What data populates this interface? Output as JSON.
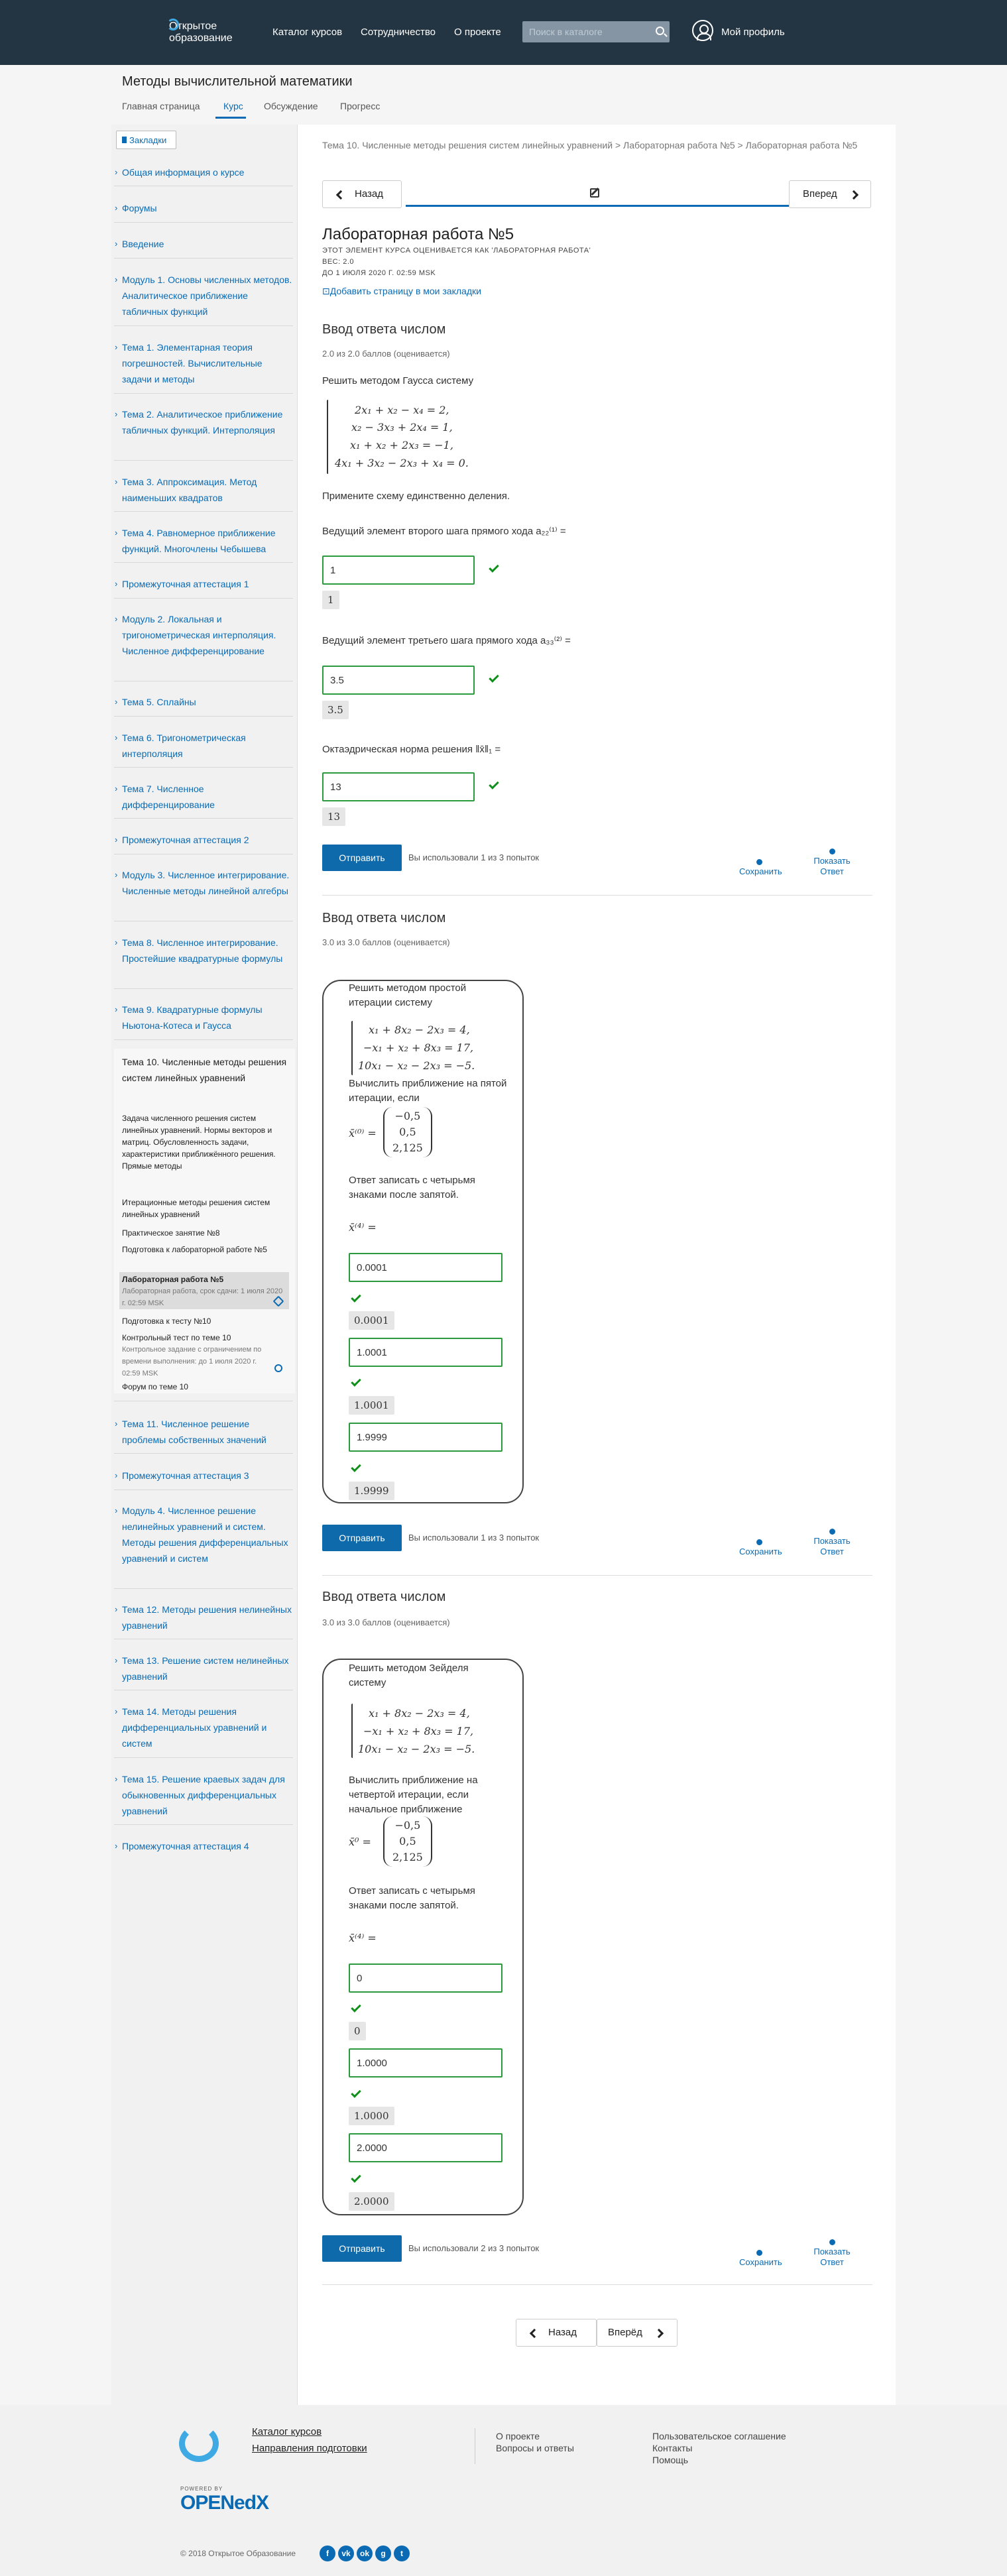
{
  "header": {
    "logo_line1": "Открытое",
    "logo_line2": "образование",
    "nav": [
      "Каталог курсов",
      "Сотрудничество",
      "О проекте"
    ],
    "search_placeholder": "Поиск в каталоге",
    "profile": "Мой профиль"
  },
  "course": {
    "title": "Методы вычислительной математики",
    "tabs": [
      "Главная страница",
      "Курс",
      "Обсуждение",
      "Прогресс"
    ],
    "active_tab": "Курс"
  },
  "sidebar": {
    "bookmarks": "Закладки",
    "items": [
      "Общая информация о курсе",
      "Форумы",
      "Введение",
      "Модуль 1. Основы численных методов. Аналитическое приближение табличных функций",
      "Тема 1. Элементарная теория погрешностей. Вычислительные задачи и методы",
      "Тема 2. Аналитическое приближение табличных функций. Интерполяция",
      "Тема 3. Аппроксимация. Метод наименьших квадратов",
      "Тема 4. Равномерное приближение функций. Многочлены Чебышева",
      "Промежуточная аттестация 1",
      "Модуль 2. Локальная и тригонометрическая интерполяция. Численное дифференцирование",
      "Тема 5. Сплайны",
      "Тема 6. Тригонометрическая интерполяция",
      "Тема 7. Численное дифференцирование",
      "Промежуточная аттестация 2",
      "Модуль 3. Численное интегрирование. Численные методы линейной алгебры",
      "Тема 8. Численное интегрирование. Простейшие квадратурные формулы",
      "Тема 9. Квадратурные формулы Ньютона-Котеса и Гаусса"
    ],
    "active_section": "Тема 10. Численные методы решения систем линейных уравнений",
    "subitems": [
      {
        "title": "Задача численного решения систем линейных уравнений. Нормы векторов и матриц. Обусловленность задачи, характеристики приближённого решения. Прямые методы",
        "note": ""
      },
      {
        "title": "Итерационные методы решения систем линейных уравнений",
        "note": ""
      },
      {
        "title": "Практическое занятие №8",
        "note": ""
      },
      {
        "title": "Подготовка к лабораторной работе №5",
        "note": ""
      },
      {
        "title": "Лабораторная работа №5",
        "note": "Лабораторная работа, срок сдачи: 1 июля 2020 г. 02:59 MSK"
      },
      {
        "title": "Подготовка к тесту №10",
        "note": ""
      },
      {
        "title": "Контрольный тест по теме 10",
        "note": "Контрольное задание с ограничением по времени выполнения: до 1 июля 2020 г. 02:59 MSK"
      },
      {
        "title": "Форум по теме 10",
        "note": ""
      }
    ],
    "items_after": [
      "Тема 11. Численное решение проблемы собственных значений",
      "Промежуточная аттестация 3",
      "Модуль 4. Численное решение нелинейных уравнений и систем. Методы решения дифференциальных уравнений и систем",
      "Тема 12. Методы решения нелинейных уравнений",
      "Тема 13. Решение систем нелинейных уравнений",
      "Тема 14. Методы решения дифференциальных уравнений и систем",
      "Тема 15. Решение краевых задач для обыкновенных дифференциальных уравнений",
      "Промежуточная аттестация 4"
    ]
  },
  "content": {
    "breadcrumb": "Тема 10. Численные методы решения систем линейных уравнений > Лабораторная работа №5 > Лабораторная работа №5",
    "prev": "Назад",
    "next": "Вперед",
    "next_bottom": "Вперёд",
    "unit_title": "Лабораторная работа №5",
    "meta1": "ЭТОТ ЭЛЕМЕНТ КУРСА ОЦЕНИВАЕТСЯ КАК 'ЛАБОРАТОРНАЯ РАБОТА'",
    "meta2": "ВЕС: 2.0",
    "meta3": "ДО 1 ИЮЛЯ 2020 Г. 02:59 MSK",
    "add_bookmark": "Добавить страницу в мои закладки",
    "submit": "Отправить",
    "save": "Сохранить",
    "show_answer": "Показать Ответ"
  },
  "problems": [
    {
      "heading": "Ввод ответа числом",
      "score": "2.0 из 2.0 баллов (оценивается)",
      "intro": "Решить методом Гаусса систему",
      "equations": [
        "2x₁ + x₂ − x₄ = 2,",
        "x₂ − 3x₃ + 2x₄ = 1,",
        "x₁ + x₂ + 2x₃ = −1,",
        "4x₁ + 3x₂ − 2x₃ + x₄ = 0."
      ],
      "note": "Примените схему единственно деления.",
      "questions": [
        "Ведущий элемент второго шага прямого хода a₂₂⁽¹⁾ =",
        "Ведущий элемент третьего шага прямого хода a₃₃⁽²⁾ =",
        "Октаэдрическая норма решения ‖x̄‖₁ ="
      ],
      "answers": [
        "1",
        "3.5",
        "13"
      ],
      "attempts": "Вы использовали 1 из 3 попыток"
    },
    {
      "heading": "Ввод ответа числом",
      "score": "3.0 из 3.0 баллов (оценивается)",
      "intro": "Решить методом простой итерации систему",
      "equations": [
        "x₁ + 8x₂ − 2x₃ = 4,",
        "−x₁ + x₂ + 8x₃ = 17,",
        "10x₁ − x₂ − 2x₃ = −5."
      ],
      "condition": "Вычислить приближение на пятой итерации, если",
      "vec_label": "x̄⁽⁰⁾ =",
      "vector": [
        "−0,5",
        "0,5",
        "2,125"
      ],
      "instruction": "Ответ записать с четырьмя знаками после запятой.",
      "answer_label": "x̄⁽⁴⁾ =",
      "answers": [
        "0.0001",
        "1.0001",
        "1.9999"
      ],
      "attempts": "Вы использовали 1 из 3 попыток"
    },
    {
      "heading": "Ввод ответа числом",
      "score": "3.0 из 3.0 баллов (оценивается)",
      "intro": "Решить методом Зейделя систему",
      "equations": [
        "x₁ + 8x₂ − 2x₃ = 4,",
        "−x₁ + x₂ + 8x₃ = 17,",
        "10x₁ − x₂ − 2x₃ = −5."
      ],
      "condition": "Вычислить приближение на четвертой итерации, если начальное приближение",
      "vec_label": "x̄⁰ =",
      "vector": [
        "−0,5",
        "0,5",
        "2,125"
      ],
      "instruction": "Ответ записать с четырьмя знаками после запятой.",
      "answer_label": "x̄⁽⁴⁾ =",
      "answers": [
        "0",
        "1.0000",
        "2.0000"
      ],
      "attempts": "Вы использовали 2 из 3 попыток"
    }
  ],
  "footer": {
    "catalog": "Каталог курсов",
    "directions": "Направления подготовки",
    "about": "О проекте",
    "faq": "Вопросы и ответы",
    "agreement": "Пользовательское соглашение",
    "contacts": "Контакты",
    "help": "Помощь",
    "powered": "POWERED BY",
    "openedx": "OPENedX",
    "copyright": "© 2018 Открытое Образование",
    "social": [
      "f",
      "vk",
      "ok",
      "g",
      "t"
    ]
  }
}
